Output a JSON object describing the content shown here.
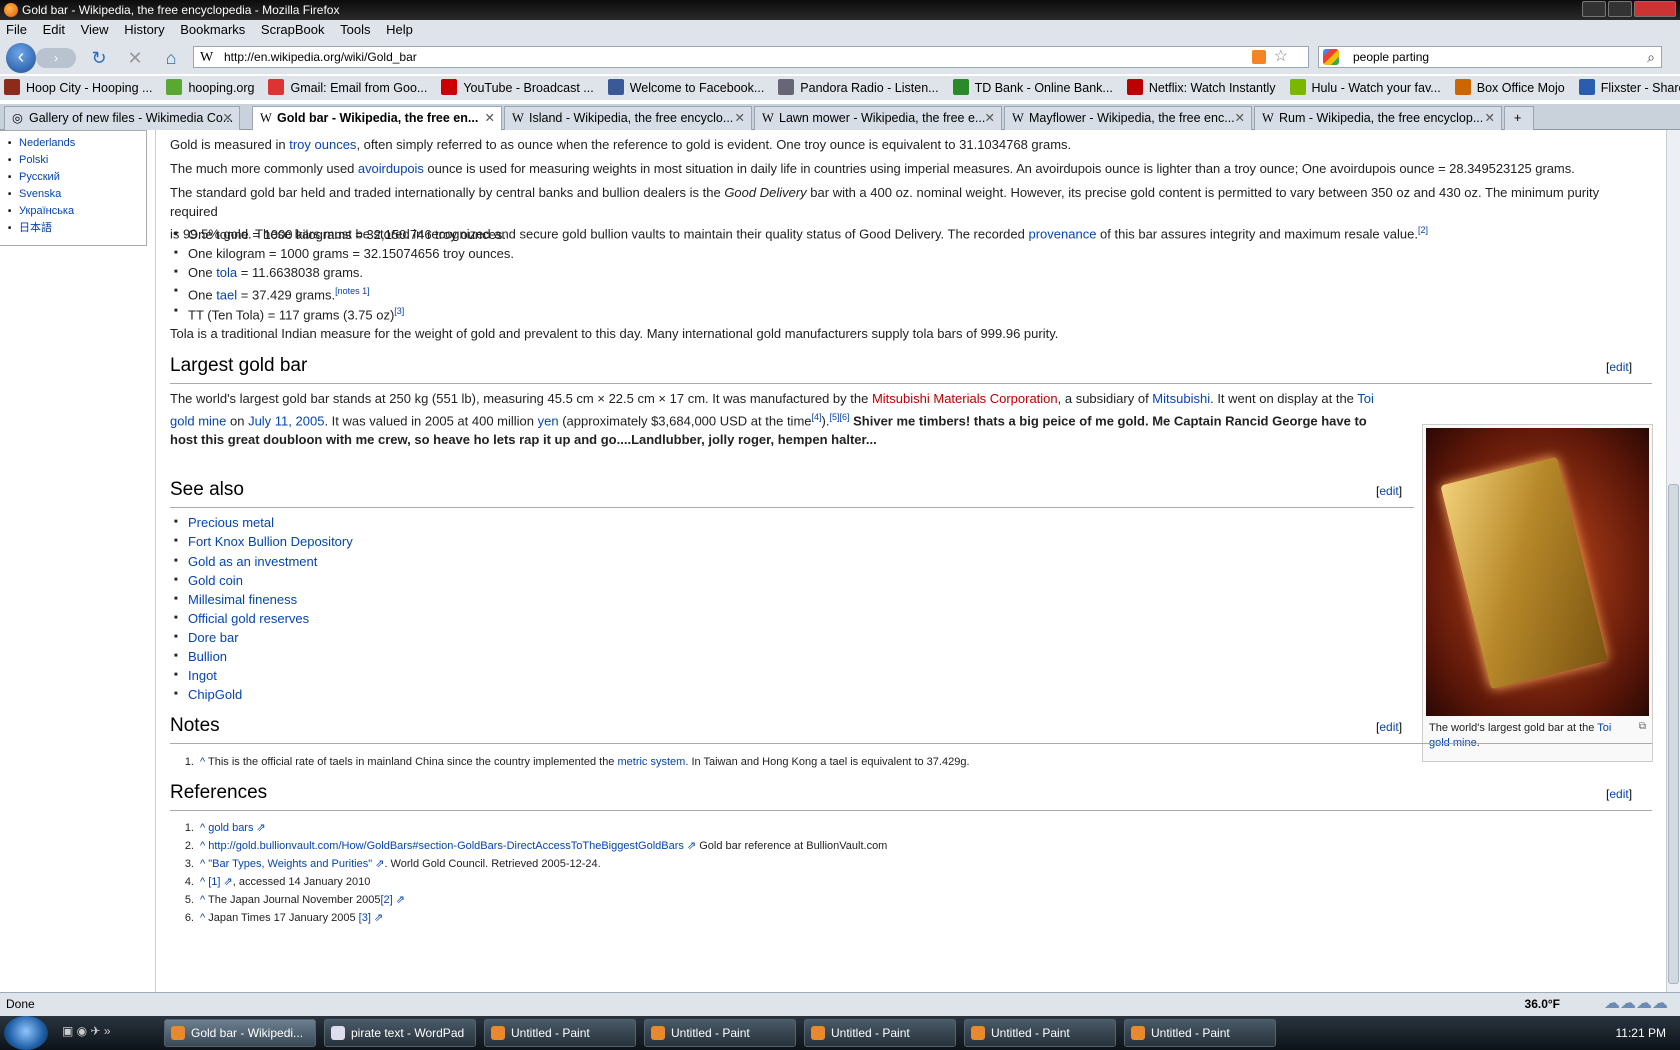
{
  "window": {
    "title": "Gold bar - Wikipedia, the free encyclopedia - Mozilla Firefox"
  },
  "menu": [
    "File",
    "Edit",
    "View",
    "History",
    "Bookmarks",
    "ScrapBook",
    "Tools",
    "Help"
  ],
  "nav": {
    "url": "http://en.wikipedia.org/wiki/Gold_bar",
    "search_value": "people parting"
  },
  "bookmarks": [
    {
      "label": "Hoop City - Hooping ...",
      "color": "#8b2b1b"
    },
    {
      "label": "hooping.org",
      "color": "#5aa832"
    },
    {
      "label": "Gmail: Email from Goo...",
      "color": "#d33"
    },
    {
      "label": "YouTube - Broadcast ...",
      "color": "#c00"
    },
    {
      "label": "Welcome to Facebook...",
      "color": "#3b5998"
    },
    {
      "label": "Pandora Radio - Listen...",
      "color": "#667"
    },
    {
      "label": "TD Bank - Online Bank...",
      "color": "#2a8a2a"
    },
    {
      "label": "Netflix: Watch Instantly",
      "color": "#b00"
    },
    {
      "label": "Hulu - Watch your fav...",
      "color": "#7ab800"
    },
    {
      "label": "Box Office Mojo",
      "color": "#c60"
    },
    {
      "label": "Flixster - Share Movie ...",
      "color": "#2a5db0"
    }
  ],
  "tabs": [
    "Gallery of new files - Wikimedia Co...",
    "Gold bar - Wikipedia, the free en...",
    "Island - Wikipedia, the free encyclo...",
    "Lawn mower - Wikipedia, the free e...",
    "Mayflower - Wikipedia, the free enc...",
    "Rum - Wikipedia, the free encyclop..."
  ],
  "sidebar": {
    "languages": [
      "Nederlands",
      "Polski",
      "Русский",
      "Svenska",
      "Українська",
      "日本語"
    ]
  },
  "article": {
    "p1": {
      "a": "Gold is measured in ",
      "link": "troy ounces",
      "b": ", often simply referred to as ounce when the reference to gold is evident. One troy ounce is equivalent to 31.1034768 grams."
    },
    "p2": {
      "a": "The much more commonly used ",
      "link": "avoirdupois",
      "b": " ounce is used for measuring weights in most situation in daily life in countries using imperial measures. An avoirdupois ounce is lighter than a troy ounce; One avoirdupois ounce = 28.349523125 grams."
    },
    "p3": {
      "a": "The standard gold bar held and traded internationally by central banks and bullion dealers is the ",
      "em": "Good Delivery",
      "b": " bar with a 400 oz. nominal weight. However, its precise gold content is permitted to vary between 350 oz and 430 oz. The minimum purity required",
      "c": "is 99.5% gold. These bars must be stored in recognized and secure gold bullion vaults to maintain their quality status of Good Delivery. The recorded ",
      "link": "provenance",
      "d": " of this bar assures integrity and maximum resale value.",
      "sup": "[2]"
    },
    "bullets": [
      {
        "a": "One tonne = 1000 kilograms = 32,150.746 troy ounces.",
        "link": "",
        "b": "",
        "sup": ""
      },
      {
        "a": "One kilogram = 1000 grams = 32.15074656 troy ounces.",
        "link": "",
        "b": "",
        "sup": ""
      },
      {
        "a": "One ",
        "link": "tola",
        "b": " = 11.6638038 grams.",
        "sup": ""
      },
      {
        "a": "One ",
        "link": "tael",
        "b": " = 37.429 grams.",
        "sup": "[notes 1]"
      },
      {
        "a": "TT (Ten Tola) = 117 grams (3.75 oz)",
        "link": "",
        "b": "",
        "sup": "[3]"
      }
    ],
    "p4": "Tola is a traditional Indian measure for the weight of gold and prevalent to this day. Many international gold manufacturers supply tola bars of 999.96 purity.",
    "h_largest": "Largest gold bar",
    "edit": "edit",
    "p5": {
      "a": "The world's largest gold bar stands at 250 kg (551 lb), measuring 45.5 cm × 22.5 cm × 17 cm. It was manufactured by the ",
      "red": "Mitsubishi Materials Corporation",
      "b": ", a subsidiary of ",
      "link1": "Mitsubishi",
      "c": ". It went on display at the ",
      "link2": "Toi",
      "link2b": "gold mine",
      "d": " on ",
      "link3": "July 11, 2005",
      "e": ". It was valued in 2005 at 400 million ",
      "link4": "yen",
      "f": " (approximately $3,684,000 USD at the time",
      "sup1": "[4]",
      "g": ").",
      "sup2": "[5][6]",
      "bold1": "Shiver me timbers! thats a big peice of me gold. Me Captain Rancid George have to",
      "bold2": "host this great doubloon with me crew, so heave ho lets rap it up and go....Landlubber, jolly roger, hempen halter..."
    },
    "thumb_caption": {
      "a": "The world's largest gold bar at the ",
      "link": "Toi",
      "link2": "gold mine",
      "b": "."
    },
    "h_seealso": "See also",
    "seealso": [
      "Precious metal",
      "Fort Knox Bullion Depository",
      "Gold as an investment",
      "Gold coin",
      "Millesimal fineness",
      "Official gold reserves",
      "Dore bar",
      "Bullion",
      "Ingot",
      "ChipGold"
    ],
    "h_notes": "Notes",
    "note1": {
      "n": "1.",
      "caret": "^",
      "a": " This is the official rate of taels in mainland China since the country implemented the ",
      "link": "metric system",
      "b": ". In Taiwan and Hong Kong a tael is equivalent to 37.429g."
    },
    "h_refs": "References",
    "refs": [
      {
        "n": "1.",
        "link": "gold bars",
        "text": ""
      },
      {
        "n": "2.",
        "link": "http://gold.bullionvault.com/How/GoldBars#section-GoldBars-DirectAccessToTheBiggestGoldBars",
        "text": " Gold bar reference at BullionVault.com"
      },
      {
        "n": "3.",
        "link": "\"Bar Types, Weights and Purities\"",
        "text": ". World Gold Council. Retrieved 2005-12-24."
      },
      {
        "n": "4.",
        "link": "[1]",
        "text": ", accessed 14 January 2010"
      },
      {
        "n": "5.",
        "link": "[2]",
        "text": "The Japan Journal November 2005"
      },
      {
        "n": "6.",
        "link": "[3]",
        "text": "Japan Times 17 January 2005 "
      }
    ]
  },
  "status": {
    "text": "Done",
    "temperature": "36.0°F"
  },
  "taskbar": {
    "items": [
      "Gold bar - Wikipedi...",
      "pirate text - WordPad",
      "Untitled - Paint",
      "Untitled - Paint",
      "Untitled - Paint",
      "Untitled - Paint",
      "Untitled - Paint"
    ],
    "clock": "11:21 PM"
  }
}
